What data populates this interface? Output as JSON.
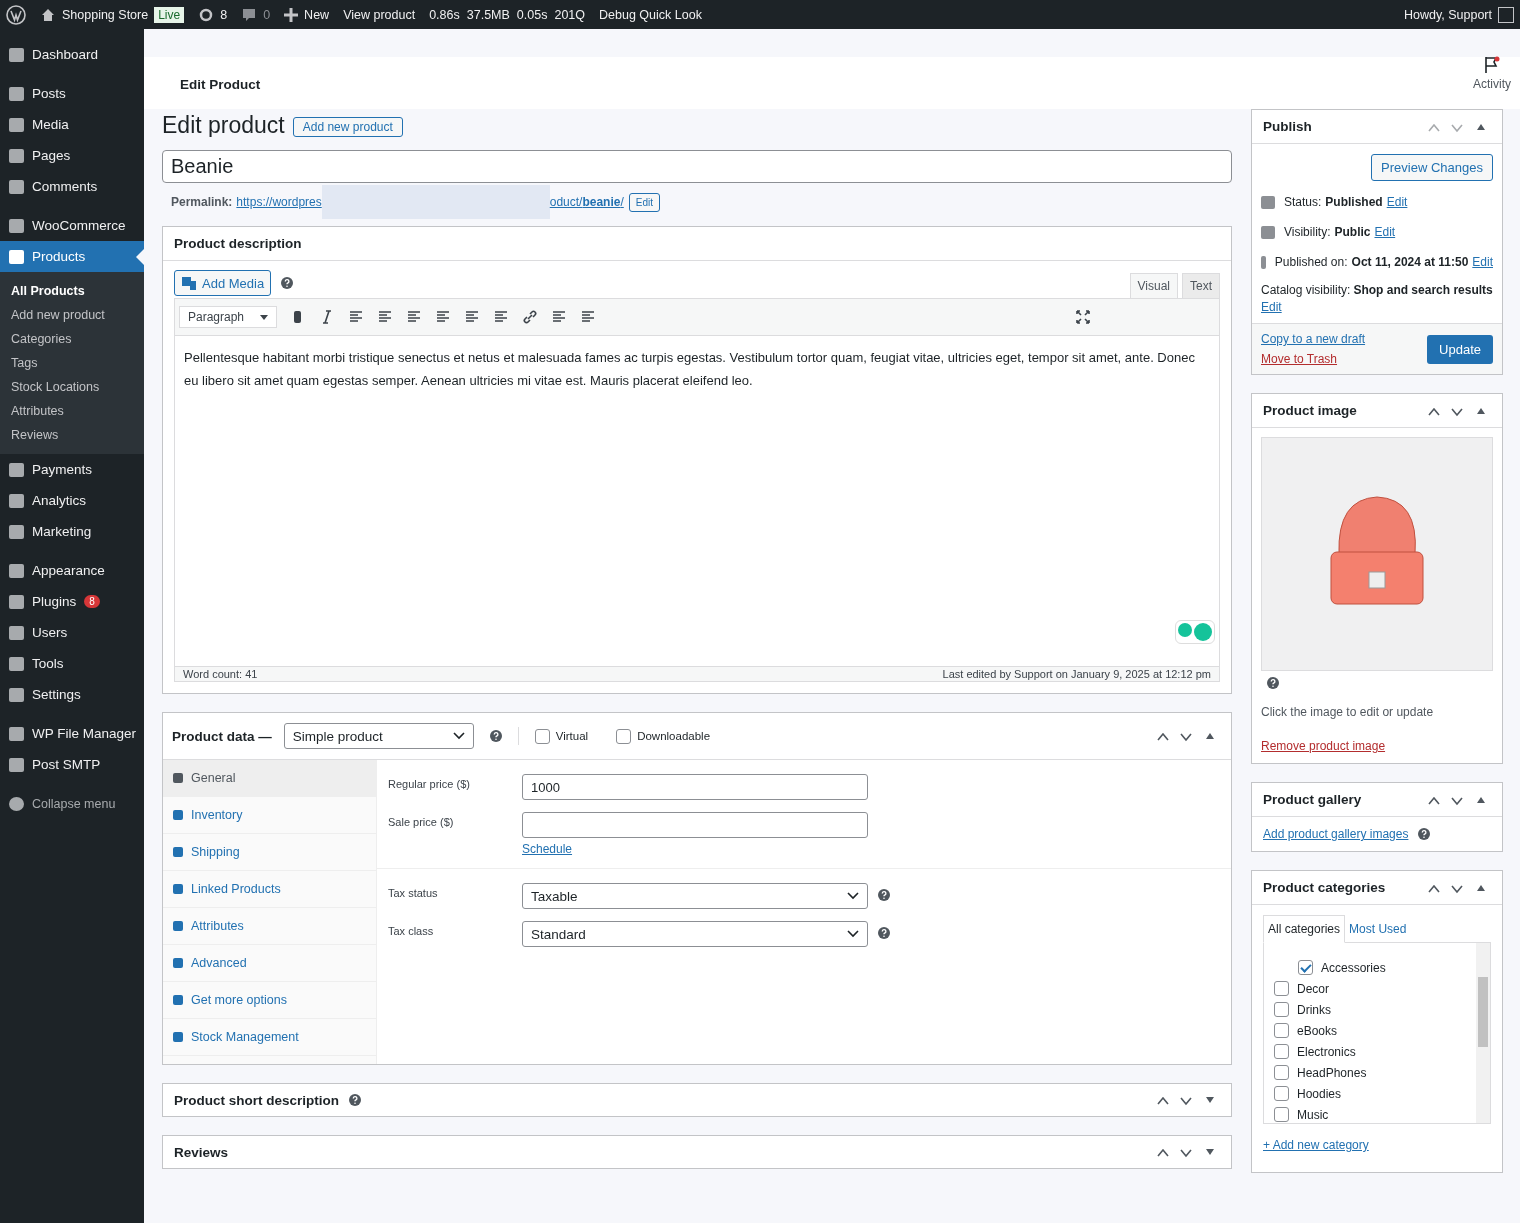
{
  "admin_bar": {
    "site": "Shopping Store",
    "env_badge": "Live",
    "updates": "8",
    "comments": "0",
    "new": "New",
    "view": "View product",
    "metrics": [
      "0.86s",
      "37.5MB",
      "0.05s",
      "201Q"
    ],
    "debug": "Debug Quick Look",
    "greeting": "Howdy, Support"
  },
  "sidebar": {
    "groups": [
      [
        {
          "label": "Dashboard",
          "selected": false
        }
      ],
      [
        {
          "label": "Posts",
          "selected": false
        },
        {
          "label": "Media",
          "selected": false
        },
        {
          "label": "Pages",
          "selected": false
        },
        {
          "label": "Comments",
          "selected": false
        }
      ],
      [
        {
          "label": "WooCommerce",
          "selected": false
        },
        {
          "label": "Products",
          "selected": true,
          "children": [
            {
              "label": "All Products",
              "selected": true
            },
            {
              "label": "Add new product",
              "selected": false
            },
            {
              "label": "Categories",
              "selected": false
            },
            {
              "label": "Tags",
              "selected": false
            },
            {
              "label": "Stock Locations",
              "selected": false
            },
            {
              "label": "Attributes",
              "selected": false
            },
            {
              "label": "Reviews",
              "selected": false
            }
          ]
        },
        {
          "label": "Payments",
          "selected": false
        },
        {
          "label": "Analytics",
          "selected": false
        },
        {
          "label": "Marketing",
          "selected": false
        }
      ],
      [
        {
          "label": "Appearance",
          "selected": false
        },
        {
          "label": "Plugins",
          "selected": false,
          "badge": "8"
        },
        {
          "label": "Users",
          "selected": false
        },
        {
          "label": "Tools",
          "selected": false
        },
        {
          "label": "Settings",
          "selected": false
        }
      ],
      [
        {
          "label": "WP File Manager",
          "selected": false
        },
        {
          "label": "Post SMTP",
          "selected": false
        }
      ]
    ],
    "collapse": "Collapse menu"
  },
  "header": {
    "title": "Edit Product",
    "activity": "Activity"
  },
  "page": {
    "heading": "Edit product",
    "add_new": "Add new product"
  },
  "title_field": {
    "value": "Beanie"
  },
  "permalink": {
    "label": "Permalink:",
    "url_start": "https://wordpres",
    "url_end": "oduct/**beanie**/",
    "edit": "Edit"
  },
  "description": {
    "title": "Product description",
    "add_media": "Add Media",
    "tabs": [
      {
        "label": "Visual",
        "selected": true
      },
      {
        "label": "Text",
        "selected": false
      }
    ],
    "format": "Paragraph",
    "body": "Pellentesque habitant morbi tristique senectus et netus et malesuada fames ac turpis egestas. Vestibulum tortor quam, feugiat vitae, ultricies eget, tempor sit amet, ante. Donec eu libero sit amet quam egestas semper. Aenean ultricies mi vitae est. Mauris placerat eleifend leo.",
    "word_count": "Word count: 41",
    "last_edited": "Last edited by Support on January 9, 2025 at 12:12 pm"
  },
  "product_data": {
    "title": "Product data —",
    "type": "Simple product",
    "options": [
      {
        "label": "Virtual",
        "checked": false
      },
      {
        "label": "Downloadable",
        "checked": false
      }
    ],
    "tabs": [
      {
        "label": "General",
        "selected": true
      },
      {
        "label": "Inventory",
        "selected": false
      },
      {
        "label": "Shipping",
        "selected": false
      },
      {
        "label": "Linked Products",
        "selected": false
      },
      {
        "label": "Attributes",
        "selected": false
      },
      {
        "label": "Advanced",
        "selected": false
      },
      {
        "label": "Get more options",
        "selected": false
      },
      {
        "label": "Stock Management",
        "selected": false
      }
    ],
    "sections": [
      [
        {
          "label": "Regular price ($)",
          "kind": "input",
          "value": "1000"
        },
        {
          "label": "Sale price ($)",
          "kind": "input",
          "link": "Schedule"
        }
      ],
      [
        {
          "label": "Tax status",
          "kind": "select",
          "value": "Taxable"
        },
        {
          "label": "Tax class",
          "kind": "select",
          "value": "Standard"
        }
      ]
    ]
  },
  "short_description": {
    "title": "Product short description"
  },
  "reviews": {
    "title": "Reviews"
  },
  "publish": {
    "title": "Publish",
    "preview": "Preview Changes",
    "rows": [
      {
        "label": "Status:",
        "value": "Published",
        "edit": "Edit"
      },
      {
        "label": "Visibility:",
        "value": "Public",
        "edit": "Edit"
      },
      {
        "label": "Published on:",
        "value": "Oct 11, 2024 at 11:50",
        "edit": "Edit"
      }
    ],
    "catalog": {
      "label": "Catalog visibility:",
      "value": "Shop and search results",
      "edit": "Edit"
    },
    "copy": "Copy to a new draft",
    "trash": "Move to Trash",
    "update": "Update"
  },
  "product_image": {
    "title": "Product image",
    "hint": "Click the image to edit or update",
    "remove": "Remove product image"
  },
  "gallery": {
    "title": "Product gallery",
    "link": "Add product gallery images"
  },
  "categories": {
    "title": "Product categories",
    "tabs": [
      {
        "label": "All categories",
        "selected": true
      },
      {
        "label": "Most Used",
        "selected": false
      }
    ],
    "items": [
      {
        "label": "Accessories",
        "checked": true
      },
      {
        "label": "Decor",
        "checked": false
      },
      {
        "label": "Drinks",
        "checked": false
      },
      {
        "label": "eBooks",
        "checked": false
      },
      {
        "label": "Electronics",
        "checked": false
      },
      {
        "label": "HeadPhones",
        "checked": false
      },
      {
        "label": "Hoodies",
        "checked": false
      },
      {
        "label": "Music",
        "checked": false
      }
    ],
    "add_new": "+ Add new category"
  }
}
